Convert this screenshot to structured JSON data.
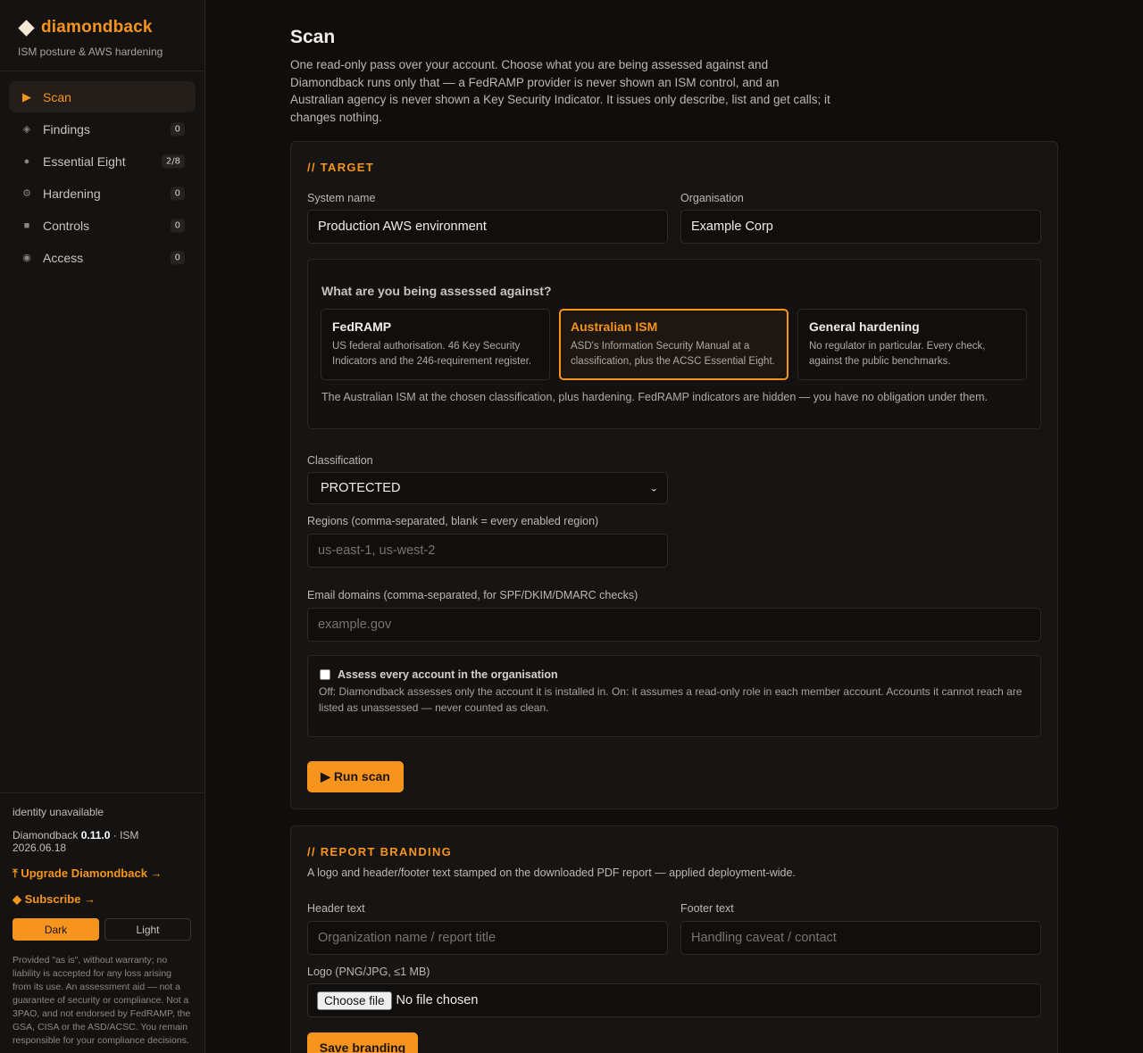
{
  "app": {
    "name": "diamondback",
    "tagline": "ISM posture & AWS hardening"
  },
  "nav": [
    {
      "label": "Scan",
      "icon": "play-icon",
      "glyph": "▶",
      "badge": null,
      "active": true
    },
    {
      "label": "Findings",
      "icon": "diamond-icon",
      "glyph": "◈",
      "badge": "0",
      "active": false
    },
    {
      "label": "Essential Eight",
      "icon": "dot-icon",
      "glyph": "●",
      "badge": "2/8",
      "active": false
    },
    {
      "label": "Hardening",
      "icon": "ring-icon",
      "glyph": "⚙",
      "badge": "0",
      "active": false
    },
    {
      "label": "Controls",
      "icon": "square-icon",
      "glyph": "■",
      "badge": "0",
      "active": false
    },
    {
      "label": "Access",
      "icon": "target-icon",
      "glyph": "◉",
      "badge": "0",
      "active": false
    }
  ],
  "sidebar_footer": {
    "identity": "identity unavailable",
    "product": "Diamondback",
    "version": "0.11.0",
    "ism": "· ISM 2026.06.18",
    "upgrade_link": "⤒ Upgrade Diamondback →",
    "subscribe_link": "◆ Subscribe →",
    "theme_dark": "Dark",
    "theme_light": "Light",
    "disclaimer": "Provided \"as is\", without warranty; no liability is accepted for any loss arising from its use. An assessment aid — not a guarantee of security or compliance. Not a 3PAO, and not endorsed by FedRAMP, the GSA, CISA or the ASD/ACSC. You remain responsible for your compliance decisions."
  },
  "page": {
    "title": "Scan",
    "description": "One read-only pass over your account. Choose what you are being assessed against and Diamondback runs only that — a FedRAMP provider is never shown an ISM control, and an Australian agency is never shown a Key Security Indicator. It issues only describe, list and get calls; it changes nothing."
  },
  "target": {
    "section_title": "// TARGET",
    "system_name_label": "System name",
    "system_name_value": "Production AWS environment",
    "organisation_label": "Organisation",
    "organisation_value": "Example Corp",
    "assess_question": "What are you being assessed against?",
    "options": [
      {
        "title": "FedRAMP",
        "desc": "US federal authorisation. 46 Key Security Indicators and the 246-requirement register.",
        "selected": false
      },
      {
        "title": "Australian ISM",
        "desc": "ASD's Information Security Manual at a classification, plus the ACSC Essential Eight.",
        "selected": true
      },
      {
        "title": "General hardening",
        "desc": "No regulator in particular. Every check, against the public benchmarks.",
        "selected": false
      }
    ],
    "assess_note": "The Australian ISM at the chosen classification, plus hardening. FedRAMP indicators are hidden — you have no obligation under them.",
    "classification_label": "Classification",
    "classification_value": "PROTECTED",
    "regions_label": "Regions (comma-separated, blank = every enabled region)",
    "regions_placeholder": "us-east-1, us-west-2",
    "email_label": "Email domains (comma-separated, for SPF/DKIM/DMARC checks)",
    "email_placeholder": "example.gov",
    "org_checkbox_label": "Assess every account in the organisation",
    "org_checkbox_checked": false,
    "org_checkbox_desc": "Off: Diamondback assesses only the account it is installed in. On: it assumes a read-only role in each member account. Accounts it cannot reach are listed as unassessed — never counted as clean.",
    "run_button": "▶ Run scan"
  },
  "branding": {
    "section_title": "// REPORT BRANDING",
    "description": "A logo and header/footer text stamped on the downloaded PDF report — applied deployment-wide.",
    "header_label": "Header text",
    "header_placeholder": "Organization name / report title",
    "footer_label": "Footer text",
    "footer_placeholder": "Handling caveat / contact",
    "logo_label": "Logo (PNG/JPG, ≤1 MB)",
    "file_button": "Choose file",
    "file_status": "No file chosen",
    "save_button": "Save branding"
  },
  "colors": {
    "accent": "#f7941d",
    "background": "#0f0e0d",
    "sidebar": "#151311",
    "card": "#171513"
  }
}
